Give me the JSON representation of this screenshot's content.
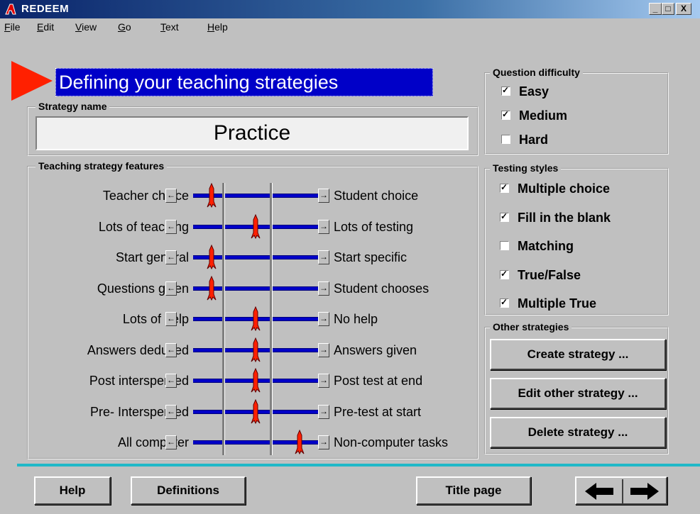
{
  "window": {
    "title": "REDEEM",
    "controls": [
      "_",
      "□",
      "X"
    ]
  },
  "menu": [
    {
      "label": "File",
      "ul": "F"
    },
    {
      "label": "Edit",
      "ul": "E"
    },
    {
      "label": "View",
      "ul": "V"
    },
    {
      "label": "Go",
      "ul": "G"
    },
    {
      "label": "Text",
      "ul": "T"
    },
    {
      "label": "Help",
      "ul": "H"
    }
  ],
  "page_title": "Defining your  teaching strategies",
  "strategy_name": {
    "legend": "Strategy name",
    "value": "Practice"
  },
  "features": {
    "legend": "Teaching strategy features",
    "sliders": [
      {
        "left": "Teacher choice",
        "right": "Student choice",
        "position": 0.15
      },
      {
        "left": "Lots of teaching",
        "right": "Lots of testing",
        "position": 0.5
      },
      {
        "left": "Start general",
        "right": "Start specific",
        "position": 0.15
      },
      {
        "left": "Questions given",
        "right": "Student chooses",
        "position": 0.15
      },
      {
        "left": "Lots of help",
        "right": "No help",
        "position": 0.5
      },
      {
        "left": "Answers deduced",
        "right": "Answers given",
        "position": 0.5
      },
      {
        "left": "Post interspersed",
        "right": "Post test at end",
        "position": 0.5
      },
      {
        "left": "Pre- Interspersed",
        "right": "Pre-test at start",
        "position": 0.5
      },
      {
        "left": "All computer",
        "right": "Non-computer tasks",
        "position": 0.85
      }
    ]
  },
  "question_difficulty": {
    "legend": "Question difficulty",
    "options": [
      {
        "label": "Easy",
        "checked": true
      },
      {
        "label": "Medium",
        "checked": true
      },
      {
        "label": "Hard",
        "checked": false
      }
    ]
  },
  "testing_styles": {
    "legend": "Testing styles",
    "options": [
      {
        "label": "Multiple choice",
        "checked": true
      },
      {
        "label": "Fill in the blank",
        "checked": true
      },
      {
        "label": "Matching",
        "checked": false
      },
      {
        "label": "True/False",
        "checked": true
      },
      {
        "label": "Multiple True",
        "checked": true
      }
    ]
  },
  "other_strategies": {
    "legend": "Other strategies",
    "buttons": [
      "Create strategy ...",
      "Edit other strategy ...",
      "Delete strategy ..."
    ]
  },
  "footer": {
    "help": "Help",
    "definitions": "Definitions",
    "title_page": "Title page"
  },
  "colors": {
    "accent": "#0000c8",
    "pointer": "#ff2000",
    "divider": "#20b8c8"
  }
}
